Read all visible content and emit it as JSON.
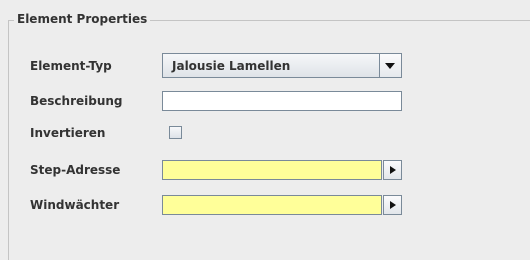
{
  "group": {
    "title": "Element Properties"
  },
  "fields": {
    "element_typ": {
      "label": "Element-Typ",
      "value": "Jalousie Lamellen",
      "icon": "chevron-down-icon"
    },
    "beschreibung": {
      "label": "Beschreibung",
      "value": ""
    },
    "invertieren": {
      "label": "Invertieren",
      "checked": false
    },
    "step_adresse": {
      "label": "Step-Adresse",
      "value": "",
      "icon": "arrow-right-icon"
    },
    "windwaechter": {
      "label": "Windwächter",
      "value": "",
      "icon": "arrow-right-icon"
    }
  },
  "colors": {
    "selector_field_background": "#ffff99",
    "panel_background": "#ededed"
  }
}
